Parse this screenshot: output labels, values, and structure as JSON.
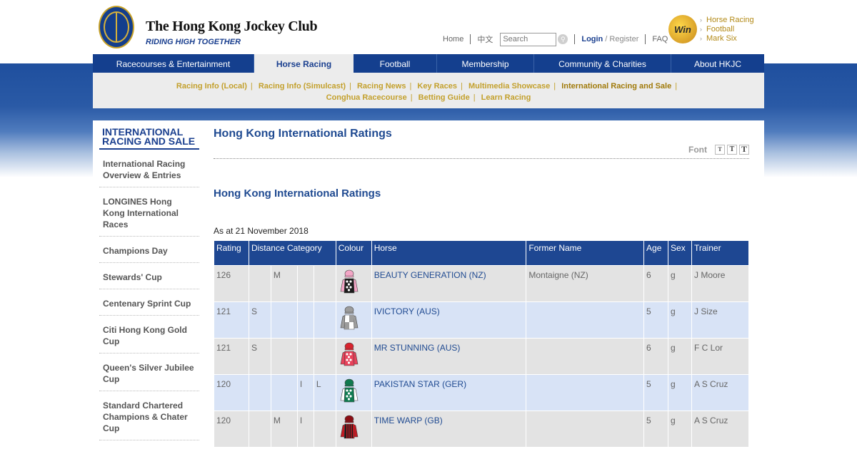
{
  "header": {
    "logo_title": "The Hong Kong Jockey Club",
    "logo_tagline": "RIDING HIGH TOGETHER",
    "util": {
      "home": "Home",
      "lang": "中文",
      "search_placeholder": "Search",
      "login": "Login",
      "register": "/ Register",
      "faq": "FAQ"
    },
    "badge_text": "Win",
    "quick_links": [
      "Horse Racing",
      "Football",
      "Mark Six"
    ]
  },
  "mainnav": [
    {
      "label": "Racecourses & Entertainment"
    },
    {
      "label": "Horse Racing"
    },
    {
      "label": "Football"
    },
    {
      "label": "Membership"
    },
    {
      "label": "Community & Charities"
    },
    {
      "label": "About HKJC"
    }
  ],
  "subnav": {
    "row1": [
      "Racing Info (Local)",
      "Racing Info (Simulcast)",
      "Racing News",
      "Key Races",
      "Multimedia Showcase",
      "International Racing and Sale"
    ],
    "row2": [
      "Conghua Racecourse",
      "Betting Guide",
      "Learn Racing"
    ]
  },
  "sidebar": {
    "title": "INTERNATIONAL RACING AND SALE",
    "items": [
      "International Racing Overview & Entries",
      "LONGINES Hong Kong International Races",
      "Champions Day",
      "Stewards' Cup",
      "Centenary Sprint Cup",
      "Citi Hong Kong Gold Cup",
      "Queen's Silver Jubilee Cup",
      "Standard Chartered Champions & Chater Cup"
    ]
  },
  "main": {
    "title": "Hong Kong International Ratings",
    "font_label": "Font",
    "font_sizes": [
      "T",
      "T",
      "T"
    ],
    "subtitle": "Hong Kong International Ratings",
    "as_at": "As at 21 November 2018"
  },
  "table": {
    "headers": {
      "rating": "Rating",
      "distance": "Distance Category",
      "colour": "Colour",
      "horse": "Horse",
      "former": "Former Name",
      "age": "Age",
      "sex": "Sex",
      "trainer": "Trainer"
    },
    "rows": [
      {
        "rating": "126",
        "d1": "",
        "d2": "M",
        "d3": "",
        "d4": "",
        "horse": "BEAUTY GENERATION (NZ)",
        "former": "Montaigne (NZ)",
        "age": "6",
        "sex": "g",
        "trainer": "J Moore",
        "silk": {
          "cap": "#f3a6c6",
          "body": "#1b1b1b",
          "sleeve": "#f3a6c6",
          "pattern": "dots-white"
        }
      },
      {
        "rating": "121",
        "d1": "S",
        "d2": "",
        "d3": "",
        "d4": "",
        "horse": "IVICTORY (AUS)",
        "former": "",
        "age": "5",
        "sex": "g",
        "trainer": "J Size",
        "silk": {
          "cap": "#9c9c9c",
          "body": "#ffffff",
          "sleeve": "#9c9c9c",
          "pattern": "quartered"
        }
      },
      {
        "rating": "121",
        "d1": "S",
        "d2": "",
        "d3": "",
        "d4": "",
        "horse": "MR STUNNING (AUS)",
        "former": "",
        "age": "6",
        "sex": "g",
        "trainer": "F C Lor",
        "silk": {
          "cap": "#d9232e",
          "body": "#e8415a",
          "sleeve": "#e8415a",
          "pattern": "dots-white"
        }
      },
      {
        "rating": "120",
        "d1": "",
        "d2": "",
        "d3": "I",
        "d4": "L",
        "horse": "PAKISTAN STAR (GER)",
        "former": "",
        "age": "5",
        "sex": "g",
        "trainer": "A S Cruz",
        "silk": {
          "cap": "#0f7a4f",
          "body": "#0f7a4f",
          "sleeve": "#ffffff",
          "pattern": "dots-white"
        }
      },
      {
        "rating": "120",
        "d1": "",
        "d2": "M",
        "d3": "I",
        "d4": "",
        "horse": "TIME WARP (GB)",
        "former": "",
        "age": "5",
        "sex": "g",
        "trainer": "A S Cruz",
        "silk": {
          "cap": "#8a0e14",
          "body": "#1b1b1b",
          "sleeve": "#c01a22",
          "pattern": "stripes-red"
        }
      }
    ]
  }
}
